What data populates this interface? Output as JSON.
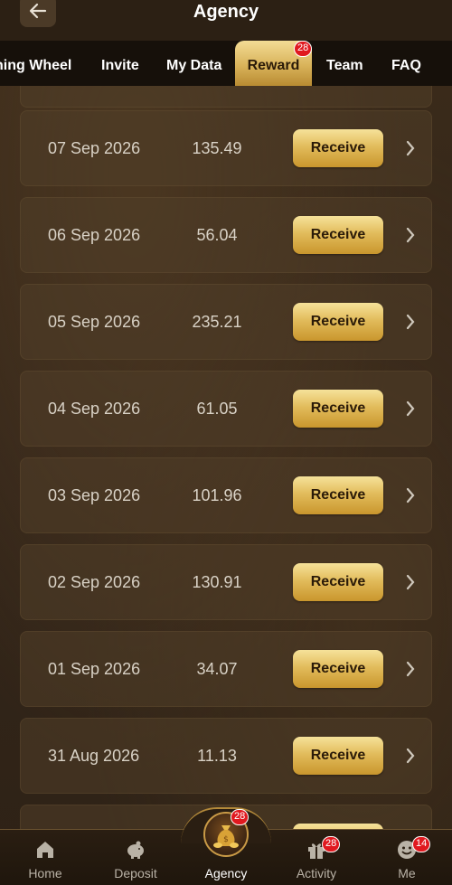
{
  "header": {
    "title": "Agency"
  },
  "tabs": [
    {
      "label": "ning Wheel"
    },
    {
      "label": "Invite"
    },
    {
      "label": "My Data"
    },
    {
      "label": "Reward",
      "badge": "28"
    },
    {
      "label": "Team"
    },
    {
      "label": "FAQ"
    }
  ],
  "rewards": [
    {
      "date": "07 Sep 2026",
      "amount": "135.49",
      "action": "Receive"
    },
    {
      "date": "06 Sep 2026",
      "amount": "56.04",
      "action": "Receive"
    },
    {
      "date": "05 Sep 2026",
      "amount": "235.21",
      "action": "Receive"
    },
    {
      "date": "04 Sep 2026",
      "amount": "61.05",
      "action": "Receive"
    },
    {
      "date": "03 Sep 2026",
      "amount": "101.96",
      "action": "Receive"
    },
    {
      "date": "02 Sep 2026",
      "amount": "130.91",
      "action": "Receive"
    },
    {
      "date": "01 Sep 2026",
      "amount": "34.07",
      "action": "Receive"
    },
    {
      "date": "31 Aug 2026",
      "amount": "11.13",
      "action": "Receive"
    }
  ],
  "nav": [
    {
      "label": "Home",
      "icon": "home-icon"
    },
    {
      "label": "Deposit",
      "icon": "piggy-bank-icon"
    },
    {
      "label": "Agency",
      "icon": "money-bag-icon",
      "badge": "28"
    },
    {
      "label": "Activity",
      "icon": "gift-icon",
      "badge": "28"
    },
    {
      "label": "Me",
      "icon": "face-icon",
      "badge": "14"
    }
  ],
  "colors": {
    "accent_gold": "#e2bc5c",
    "badge_red": "#e0191f",
    "background": "#3a2a19"
  }
}
